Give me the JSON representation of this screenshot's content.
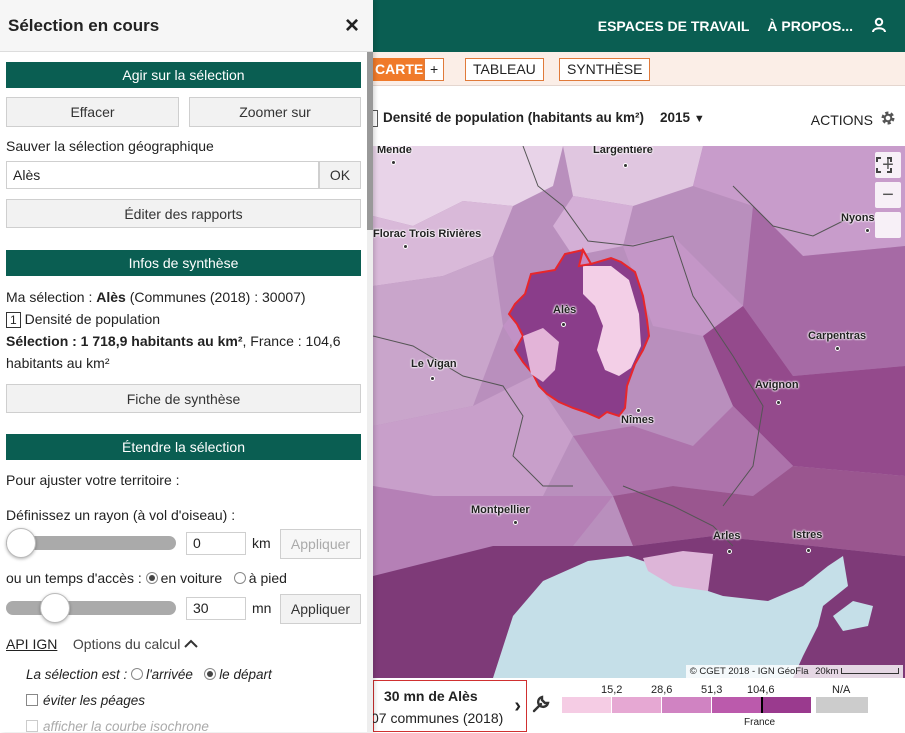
{
  "topnav": {
    "workspaces": "ESPACES DE TRAVAIL",
    "about": "À PROPOS...",
    "user_icon": "user-icon"
  },
  "tabs": {
    "map": "CARTE",
    "add": "+",
    "table": "TABLEAU",
    "synthesis": "SYNTHÈSE"
  },
  "indicator": {
    "title": "Densité de population (habitants au km²)",
    "year": "2015",
    "actions": "ACTIONS"
  },
  "panel": {
    "title": "Sélection en cours",
    "close": "×",
    "act_header": "Agir sur la sélection",
    "erase": "Effacer",
    "zoom_on": "Zoomer sur",
    "save_label": "Sauver la sélection géographique",
    "save_value": "Alès",
    "ok": "OK",
    "edit_reports": "Éditer des rapports",
    "infos_header": "Infos de synthèse",
    "my_selection_prefix": "Ma sélection : ",
    "my_selection_name": "Alès",
    "my_selection_suffix": " (Communes (2018) : 30007)",
    "indicator_num": "1",
    "indicator_name": "Densité de population",
    "sel_value_bold": "Sélection : 1 718,9 habitants au km²",
    "sel_value_rest": ", France : 104,6",
    "sel_value_line2": "habitants au km²",
    "synthesis_sheet": "Fiche de synthèse",
    "extend_header": "Étendre la sélection",
    "adjust": "Pour ajuster votre territoire :",
    "radius_label": "Définissez un rayon (à vol d'oiseau) :",
    "radius_value": "0",
    "radius_unit": "km",
    "apply": "Appliquer",
    "access_label": "ou un temps d'accès :",
    "by_car": "en voiture",
    "on_foot": "à pied",
    "time_value": "30",
    "time_unit": "mn",
    "api_ign": "API IGN",
    "calc_options": "Options du calcul",
    "selection_is": "La sélection est :",
    "arrival": "l'arrivée",
    "departure": "le départ",
    "avoid_tolls": "éviter les péages",
    "show_isochrone": "afficher la courbe isochrone"
  },
  "map": {
    "cities": [
      "Mende",
      "Largentière",
      "Florac Trois Rivières",
      "Nyons",
      "Alès",
      "Carpentras",
      "Le Vigan",
      "Avignon",
      "Nîmes",
      "Montpellier",
      "Arles",
      "Istres"
    ],
    "zoom_in": "+",
    "zoom_out": "−",
    "attribution": "© CGET 2018 - IGN GéoFla",
    "scale": "20km"
  },
  "legend": {
    "selection_title": "30 mn de Alès",
    "selection_sub": "07 communes (2018)",
    "breaks": [
      "15,2",
      "28,6",
      "51,3",
      "104,6"
    ],
    "na": "N/A",
    "france": "France",
    "colors": [
      "#f5cce4",
      "#e6a8d3",
      "#d083c2",
      "#bb5aac",
      "#9a3a8e",
      "#cccccc"
    ]
  }
}
